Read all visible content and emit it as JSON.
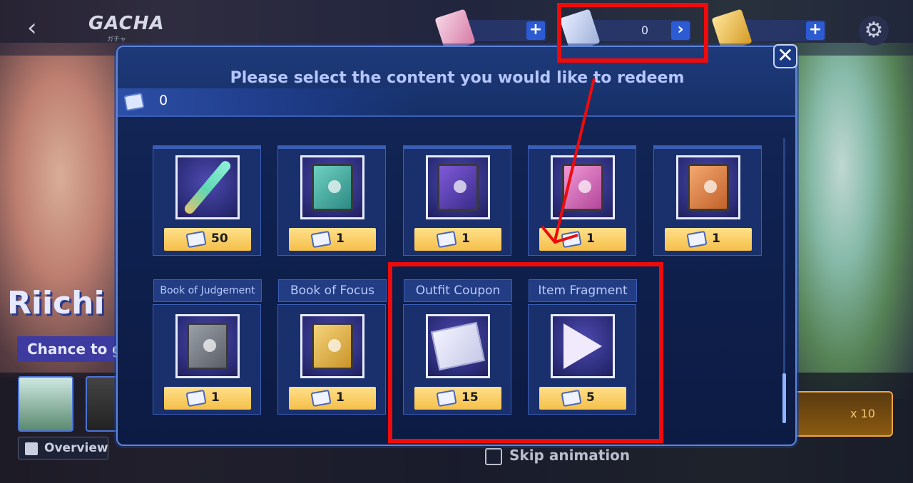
{
  "header": {
    "back_icon": "chevron-left-icon",
    "title": "GACHA",
    "subtitle": "ガチャ",
    "settings_icon": "gear-icon"
  },
  "currencies": [
    {
      "name": "gacha-ticket-pink",
      "value": "",
      "action": "+"
    },
    {
      "name": "redeem-ticket",
      "value": "0",
      "action": "›"
    },
    {
      "name": "gacha-ticket-gold",
      "value": "",
      "action": "+"
    }
  ],
  "banner": {
    "title": "Riichi",
    "subtitle": "Chance to g",
    "overview_label": "Overview",
    "skip_animation_label": "Skip animation",
    "pull_label": "x 10"
  },
  "modal": {
    "title": "Please select the content you would like to redeem",
    "balance": "0",
    "close_label": "✕",
    "items_row1": [
      {
        "label": "",
        "cost": "50",
        "art": "bat"
      },
      {
        "label": "",
        "cost": "1",
        "art": "book-teal"
      },
      {
        "label": "",
        "cost": "1",
        "art": "book-purple"
      },
      {
        "label": "",
        "cost": "1",
        "art": "book-pink"
      },
      {
        "label": "",
        "cost": "1",
        "art": "book-orange"
      }
    ],
    "items_row2": [
      {
        "label": "Book of Judgement",
        "cost": "1",
        "art": "book-gray"
      },
      {
        "label": "Book of Focus",
        "cost": "1",
        "art": "book-yellow"
      },
      {
        "label": "Outfit Coupon",
        "cost": "15",
        "art": "coupon"
      },
      {
        "label": "Item Fragment",
        "cost": "5",
        "art": "fragment"
      }
    ]
  },
  "colors": {
    "highlight": "#ee0b0b",
    "cost_gold": "#f5c04a",
    "modal_border": "#5f86d9"
  }
}
